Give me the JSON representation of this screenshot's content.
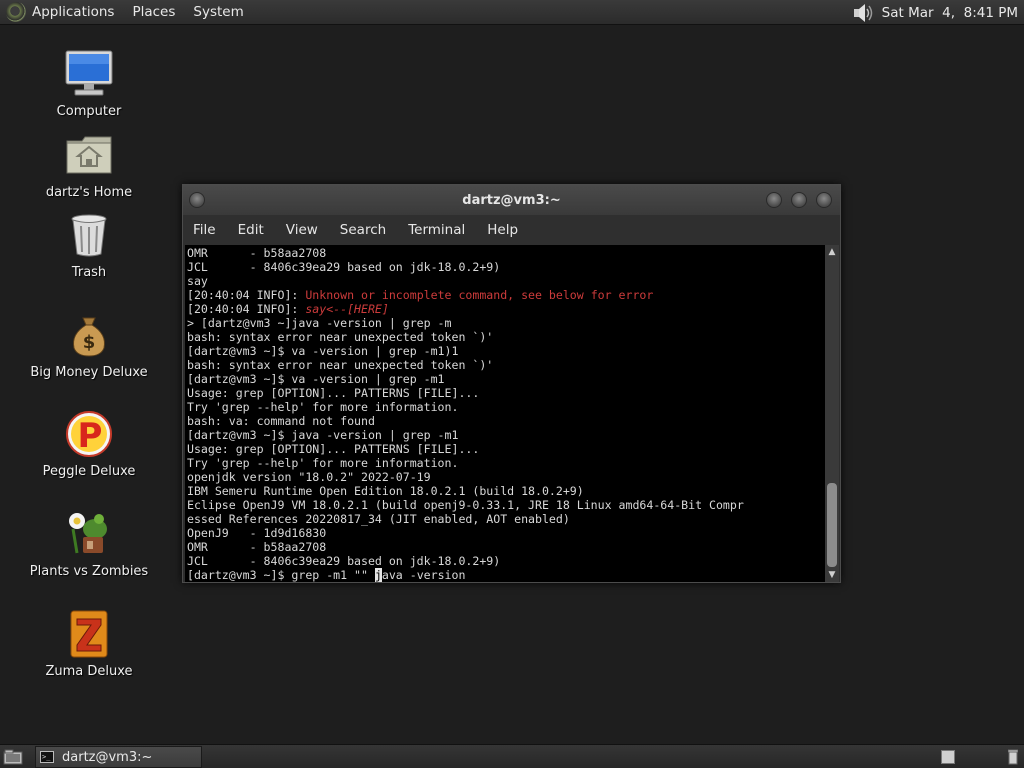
{
  "top_panel": {
    "menus": [
      "Applications",
      "Places",
      "System"
    ],
    "clock": "Sat Mar  4,  8:41 PM",
    "icons": [
      "system-logo-icon",
      "speaker-icon"
    ]
  },
  "desktop": {
    "icons": [
      {
        "label": "Computer",
        "icon": "computer-icon"
      },
      {
        "label": "dartz's Home",
        "icon": "home-folder-icon"
      },
      {
        "label": "Trash",
        "icon": "trash-icon"
      },
      {
        "label": "Big Money Deluxe",
        "icon": "money-bag-icon"
      },
      {
        "label": "Peggle Deluxe",
        "icon": "peggle-icon"
      },
      {
        "label": "Plants vs Zombies",
        "icon": "plants-vs-zombies-icon"
      },
      {
        "label": "Zuma Deluxe",
        "icon": "zuma-icon"
      }
    ]
  },
  "terminal": {
    "title": "dartz@vm3:~",
    "menus": [
      "File",
      "Edit",
      "View",
      "Search",
      "Terminal",
      "Help"
    ],
    "lines": [
      "OMR      - b58aa2708",
      "JCL      - 8406c39ea29 based on jdk-18.0.2+9)",
      "say",
      "[20:40:04 INFO]: ",
      "[20:40:04 INFO]: ",
      "> [dartz@vm3 ~]java -version | grep -m",
      "bash: syntax error near unexpected token `)'",
      "[dartz@vm3 ~]$ va -version | grep -m1)1",
      "bash: syntax error near unexpected token `)'",
      "[dartz@vm3 ~]$ va -version | grep -m1",
      "Usage: grep [OPTION]... PATTERNS [FILE]...",
      "Try 'grep --help' for more information.",
      "bash: va: command not found",
      "[dartz@vm3 ~]$ java -version | grep -m1",
      "Usage: grep [OPTION]... PATTERNS [FILE]...",
      "Try 'grep --help' for more information.",
      "openjdk version \"18.0.2\" 2022-07-19",
      "IBM Semeru Runtime Open Edition 18.0.2.1 (build 18.0.2+9)",
      "Eclipse OpenJ9 VM 18.0.2.1 (build openj9-0.33.1, JRE 18 Linux amd64-64-Bit Compr",
      "essed References 20220817_34 (JIT enabled, AOT enabled)",
      "OpenJ9   - 1d9d16830",
      "OMR      - b58aa2708",
      "JCL      - 8406c39ea29 based on jdk-18.0.2+9)",
      "[dartz@vm3 ~]$ grep -m1 \"\" "
    ],
    "error_line_1": "Unknown or incomplete command, see below for error",
    "error_line_2": "say<--[HERE]",
    "cursor_char": "j",
    "after_cursor": "ava -version",
    "error_color": "#cc3b3b"
  },
  "bottom_panel": {
    "task_label": "dartz@vm3:~",
    "icons": [
      "show-desktop-icon",
      "terminal-task-icon",
      "workspace-switcher-icon"
    ]
  }
}
